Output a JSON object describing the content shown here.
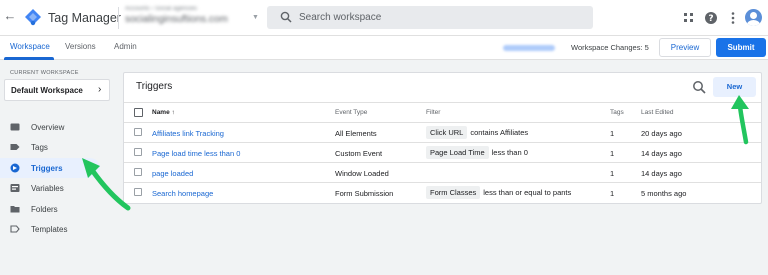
{
  "app": {
    "title": "Tag Manager"
  },
  "account": {
    "line1": "Accounts › Social agencies",
    "line2": "socialinginsuftions.com"
  },
  "search": {
    "placeholder": "Search workspace"
  },
  "topbar_icons": [
    "apps-grid-icon",
    "help-icon",
    "more-vert-icon",
    "avatar"
  ],
  "tabs": [
    {
      "label": "Workspace",
      "active": true
    },
    {
      "label": "Versions",
      "active": false
    },
    {
      "label": "Admin",
      "active": false
    }
  ],
  "subbar": {
    "workspace_changes": "Workspace Changes: 5",
    "preview_label": "Preview",
    "submit_label": "Submit"
  },
  "sidebar": {
    "current_workspace_label": "CURRENT WORKSPACE",
    "workspace_name": "Default Workspace",
    "items": [
      {
        "label": "Overview",
        "icon": "overview-icon",
        "active": false
      },
      {
        "label": "Tags",
        "icon": "tag-icon",
        "active": false
      },
      {
        "label": "Triggers",
        "icon": "trigger-icon",
        "active": true
      },
      {
        "label": "Variables",
        "icon": "variables-icon",
        "active": false
      },
      {
        "label": "Folders",
        "icon": "folder-icon",
        "active": false
      },
      {
        "label": "Templates",
        "icon": "template-icon",
        "active": false
      }
    ]
  },
  "triggers": {
    "title": "Triggers",
    "new_label": "New",
    "columns": {
      "name": "Name ↑",
      "event_type": "Event Type",
      "filter": "Filter",
      "tags": "Tags",
      "last_edited": "Last Edited"
    },
    "rows": [
      {
        "name": "Affiliates link Tracking",
        "event_type": "All Elements",
        "filter_var": "Click URL",
        "filter_rest": "contains Affiliates",
        "tags": "1",
        "last_edited": "20 days ago"
      },
      {
        "name": "Page load time less than 0",
        "event_type": "Custom Event",
        "filter_var": "Page Load Time",
        "filter_rest": "less than 0",
        "tags": "1",
        "last_edited": "14 days ago"
      },
      {
        "name": "page loaded",
        "event_type": "Window Loaded",
        "filter_var": "",
        "filter_rest": "",
        "tags": "1",
        "last_edited": "14 days ago"
      },
      {
        "name": "Search homepage",
        "event_type": "Form Submission",
        "filter_var": "Form Classes",
        "filter_rest": "less than or equal to pants",
        "tags": "1",
        "last_edited": "5 months ago"
      }
    ]
  },
  "colors": {
    "accent": "#1a73e8",
    "link": "#1967d2",
    "annotation_arrow": "#22c55e"
  }
}
